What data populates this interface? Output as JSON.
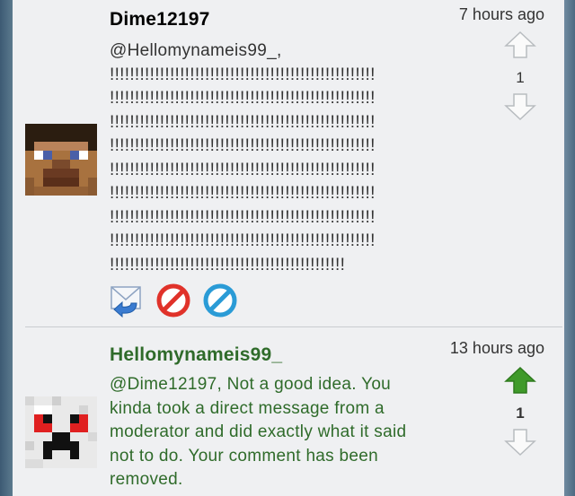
{
  "comments": [
    {
      "username": "Dime12197",
      "time": "7 hours ago",
      "body": "@Hellomynameis99_,\n!!!!!!!!!!!!!!!!!!!!!!!!!!!!!!!!!!!!!!!!!!!!!!!!!!!!!\n!!!!!!!!!!!!!!!!!!!!!!!!!!!!!!!!!!!!!!!!!!!!!!!!!!!!!\n!!!!!!!!!!!!!!!!!!!!!!!!!!!!!!!!!!!!!!!!!!!!!!!!!!!!!\n!!!!!!!!!!!!!!!!!!!!!!!!!!!!!!!!!!!!!!!!!!!!!!!!!!!!!\n!!!!!!!!!!!!!!!!!!!!!!!!!!!!!!!!!!!!!!!!!!!!!!!!!!!!!\n!!!!!!!!!!!!!!!!!!!!!!!!!!!!!!!!!!!!!!!!!!!!!!!!!!!!!\n!!!!!!!!!!!!!!!!!!!!!!!!!!!!!!!!!!!!!!!!!!!!!!!!!!!!!\n!!!!!!!!!!!!!!!!!!!!!!!!!!!!!!!!!!!!!!!!!!!!!!!!!!!!!\n!!!!!!!!!!!!!!!!!!!!!!!!!!!!!!!!!!!!!!!!!!!!!!!",
      "score": "1",
      "username_color": "#222222",
      "upvoted": false
    },
    {
      "username": "Hellomynameis99_",
      "time": "13 hours ago",
      "body": "@Dime12197, Not a good idea. You\nkinda took a direct message from a\nmoderator and did exactly what it said\nnot to do. Your comment has been\nremoved.",
      "score": "1",
      "username_color": "#2f6b2a",
      "upvoted": true
    }
  ],
  "icons": {
    "reply": "reply-icon",
    "delete": "delete-icon",
    "block": "block-icon",
    "upvote": "upvote-arrow-icon",
    "downvote": "downvote-arrow-icon"
  },
  "colors": {
    "upvote_active": "#3f9a2a",
    "delete_red": "#e0322a",
    "block_blue": "#2a9bd6"
  }
}
